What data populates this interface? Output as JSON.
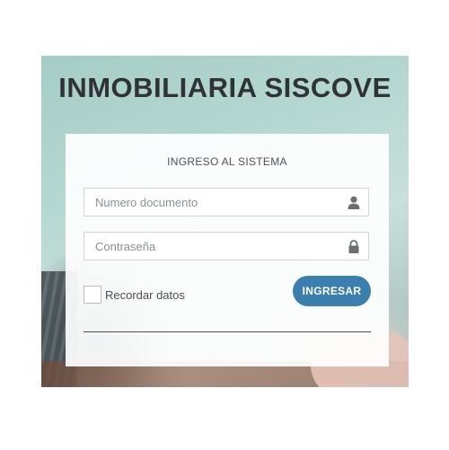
{
  "header": {
    "title": "INMOBILIARIA SISCOVE"
  },
  "login": {
    "title": "INGRESO AL SISTEMA",
    "document_placeholder": "Numero documento",
    "password_placeholder": "Contraseña",
    "remember_label": "Recordar datos",
    "submit_label": "INGRESAR"
  },
  "icons": {
    "document": "user-icon",
    "password": "lock-icon"
  },
  "colors": {
    "button": "#3a7fae",
    "title": "#2f3336"
  }
}
